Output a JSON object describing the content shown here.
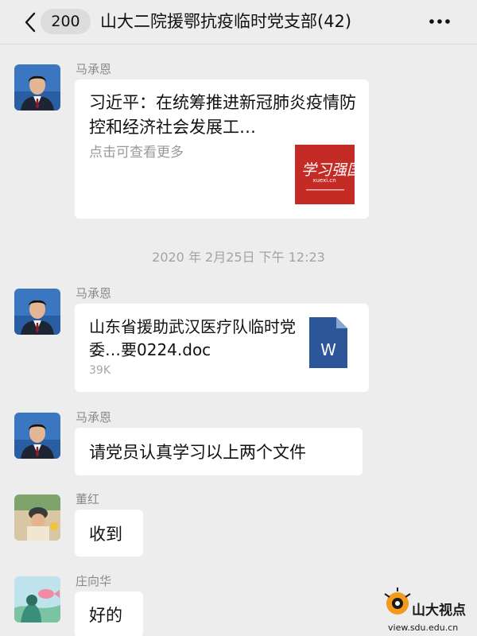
{
  "header": {
    "unread_count": "200",
    "title": "山大二院援鄂抗疫临时党支部(42)"
  },
  "messages": [
    {
      "sender": "马承恩",
      "type": "link",
      "title": "习近平：在统筹推进新冠肺炎疫情防控和经济社会发展工…",
      "description": "点击可查看更多",
      "thumb_brand": "学习强国",
      "thumb_small": "xuexi.cn"
    },
    {
      "sender": "马承恩",
      "type": "file",
      "file_name": "山东省援助武汉医疗队临时党委…要0224.doc",
      "file_size": "39K",
      "file_icon_letter": "W"
    },
    {
      "sender": "马承恩",
      "type": "text",
      "text": "请党员认真学习以上两个文件"
    },
    {
      "sender": "董红",
      "type": "text",
      "text": "收到"
    },
    {
      "sender": "庄向华",
      "type": "text",
      "text": "好的"
    }
  ],
  "timestamp": "2020 年 2月25日 下午 12:23",
  "watermark": {
    "name": "山大视点",
    "url": "view.sdu.edu.cn"
  },
  "colors": {
    "background": "#ededed",
    "bubble": "#ffffff",
    "word_icon": "#2b579a",
    "thumb_red": "#c42b25",
    "watermark_orange": "#f29a1d"
  },
  "icons": [
    "back-chevron-icon",
    "more-icon",
    "word-file-icon"
  ]
}
